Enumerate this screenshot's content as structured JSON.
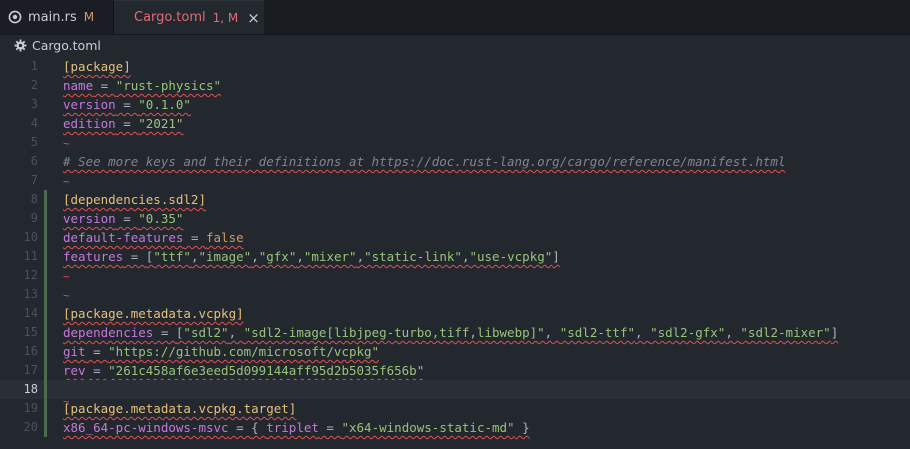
{
  "tabs": [
    {
      "name": "main.rs",
      "status": "M",
      "icon": "rust-icon",
      "active": false
    },
    {
      "name": "Cargo.toml",
      "status": "1, M",
      "icon": "gear-icon",
      "active": true,
      "close": "×"
    }
  ],
  "breadcrumb": {
    "file": "Cargo.toml",
    "icon": "gear-icon"
  },
  "editor": {
    "current_line": 18,
    "line_numbers": [
      "1",
      "2",
      "3",
      "4",
      "5",
      "6",
      "7",
      "8",
      "9",
      "10",
      "11",
      "12",
      "13",
      "14",
      "15",
      "16",
      "17",
      "18",
      "19",
      "20"
    ],
    "lines": {
      "l1_section": "[package]",
      "l2_key": "name",
      "l2_eq": " = ",
      "l2_val": "\"rust-physics\"",
      "l3_key": "version",
      "l3_eq": " = ",
      "l3_val": "\"0.1.0\"",
      "l4_key": "edition",
      "l4_eq": " = ",
      "l4_val": "\"2021\"",
      "l5_tilde": "~",
      "l6_comment": "# See more keys and their definitions at https://doc.rust-lang.org/cargo/reference/manifest.html",
      "l7_tilde": "~",
      "l8_section": "[dependencies.sdl2]",
      "l9_key": "version",
      "l9_eq": " = ",
      "l9_val": "\"0.35\"",
      "l10_key": "default-features",
      "l10_eq": " = ",
      "l10_val": "false",
      "l11_key": "features",
      "l11_eq": " = ",
      "l11_open": "[",
      "l11_items": [
        "\"ttf\"",
        "\"image\"",
        "\"gfx\"",
        "\"mixer\"",
        "\"static-link\"",
        "\"use-vcpkg\""
      ],
      "l11_sep": ",",
      "l11_close": "]",
      "l12_tilde": "~",
      "l13_tilde": "~",
      "l14_section": "[package.metadata.vcpkg]",
      "l15_key": "dependencies",
      "l15_eq": " = ",
      "l15_open": "[",
      "l15_items": [
        "\"sdl2\"",
        "\"sdl2-image[libjpeg-turbo,tiff,libwebp]\"",
        "\"sdl2-ttf\"",
        "\"sdl2-gfx\"",
        "\"sdl2-mixer\""
      ],
      "l15_sep": ", ",
      "l15_close": "]",
      "l16_key": "git",
      "l16_eq": " = ",
      "l16_val": "\"https://github.com/microsoft/vcpkg\"",
      "l17_key": "rev",
      "l17_eq": " = ",
      "l17_val": "\"261c458af6e3eed5d099144aff95d2b5035f656b\"",
      "l18_tilde": "~",
      "l19_section": "[package.metadata.vcpkg.target]",
      "l20_key": "x86_64-pc-windows-msvc",
      "l20_eq": " = ",
      "l20_open": "{ ",
      "l20_inner_key": "triplet",
      "l20_inner_eq": " = ",
      "l20_inner_val": "\"x64-windows-static-md\"",
      "l20_close": " }"
    }
  },
  "colors": {
    "accent_error": "#e06c75",
    "modified": "#d19a66",
    "section": "#e5c07b",
    "key": "#c678dd",
    "string": "#98c379",
    "comment": "#7f848e",
    "squiggle": "#e05252"
  }
}
